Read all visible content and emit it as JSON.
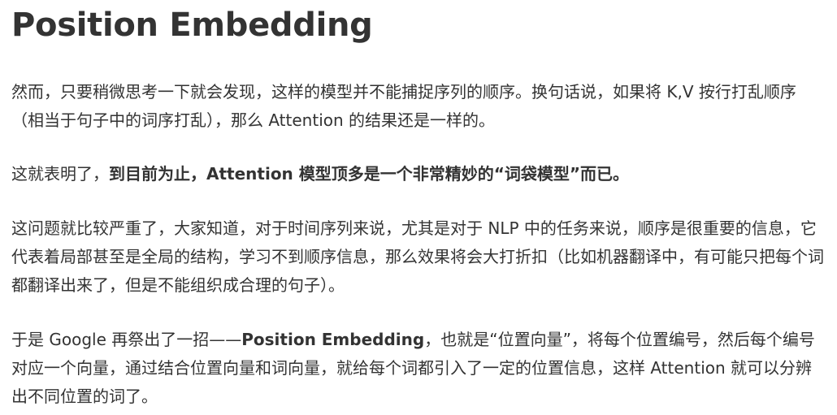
{
  "article": {
    "title": "Position Embedding",
    "p1": "然而，只要稍微思考一下就会发现，这样的模型并不能捕捉序列的顺序。换句话说，如果将 K,V 按行打乱顺序（相当于句子中的词序打乱），那么 Attention 的结果还是一样的。",
    "p2_lead": "这就表明了，",
    "p2_bold": "到目前为止，Attention 模型顶多是一个非常精妙的“词袋模型”而已。",
    "p3": "这问题就比较严重了，大家知道，对于时间序列来说，尤其是对于 NLP 中的任务来说，顺序是很重要的信息，它代表着局部甚至是全局的结构，学习不到顺序信息，那么效果将会大打折扣（比如机器翻译中，有可能只把每个词都翻译出来了，但是不能组织成合理的句子）。",
    "p4_lead": "于是 Google 再祭出了一招——",
    "p4_bold": "Position Embedding",
    "p4_tail": "，也就是“位置向量”，将每个位置编号，然后每个编号对应一个向量，通过结合位置向量和词向量，就给每个词都引入了一定的位置信息，这样 Attention 就可以分辨出不同位置的词了。"
  }
}
